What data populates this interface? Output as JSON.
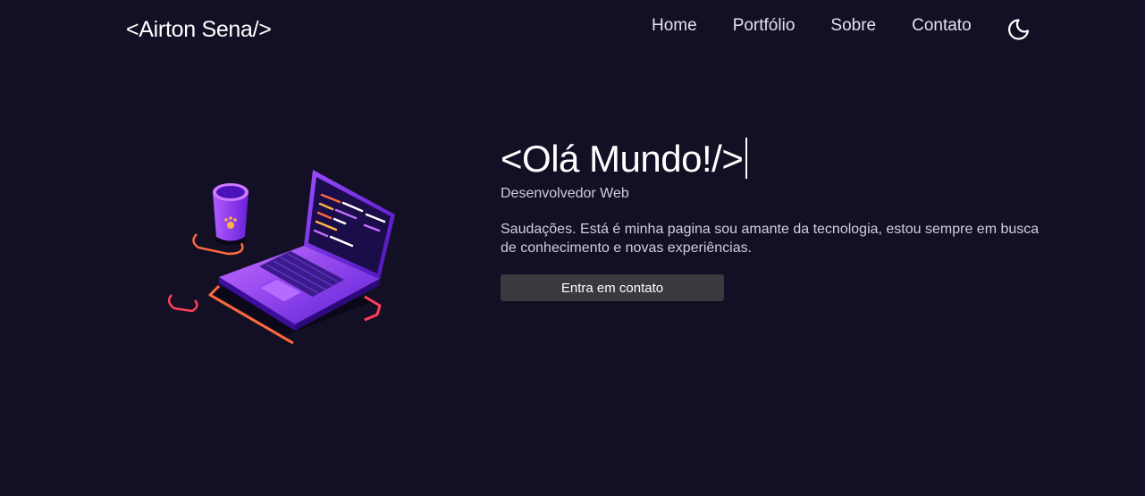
{
  "header": {
    "logo": "<Airton Sena/>",
    "nav": [
      "Home",
      "Portfólio",
      "Sobre",
      "Contato"
    ],
    "theme_toggle_icon": "moon-icon"
  },
  "hero": {
    "title": "<Olá Mundo!/>",
    "subtitle": "Desenvolvedor Web",
    "text": "Saudações. Está é minha pagina sou amante da tecnologia, estou sempre em busca de conhecimento e novas experiências.",
    "button_label": "Entra em contato"
  },
  "colors": {
    "background": "#130f25",
    "accent_purple": "#7b2ff7",
    "accent_orange": "#ff6a3d",
    "button_bg": "#3a3a3e"
  }
}
